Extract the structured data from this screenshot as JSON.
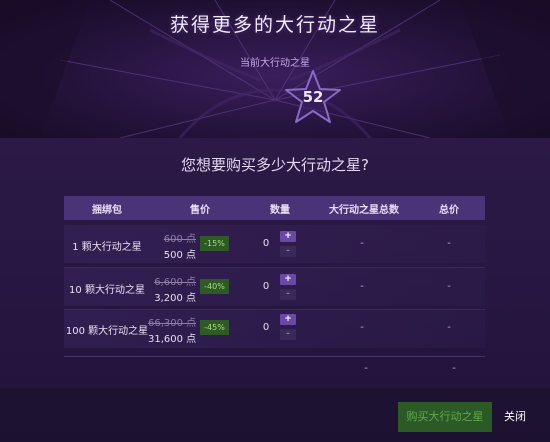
{
  "header": {
    "title": "获得更多的大行动之星",
    "current_label": "当前大行动之星",
    "current_count": "52"
  },
  "question": "您想要购买多少大行动之星?",
  "table": {
    "columns": [
      "捆绑包",
      "售价",
      "数量",
      "大行动之星总数",
      "总价"
    ],
    "rows": [
      {
        "bundle": "1 颗大行动之星",
        "old_price": "600 点",
        "new_price": "500 点",
        "discount": "-15%",
        "quantity": "0",
        "total_stars": "-",
        "total_price": "-"
      },
      {
        "bundle": "10 颗大行动之星",
        "old_price": "6,600 点",
        "new_price": "3,200 点",
        "discount": "-40%",
        "quantity": "0",
        "total_stars": "-",
        "total_price": "-"
      },
      {
        "bundle": "100 颗大行动之星",
        "old_price": "66,300 点",
        "new_price": "31,600 点",
        "discount": "-45%",
        "quantity": "0",
        "total_stars": "-",
        "total_price": "-"
      }
    ],
    "plus_label": "+",
    "minus_label": "-",
    "totals": {
      "total_stars": "-",
      "total_price": "-"
    }
  },
  "footer": {
    "buy_label": "购买大行动之星",
    "close_label": "关闭"
  },
  "colors": {
    "accent": "#6a48a6",
    "discount_bg": "#2f5a28",
    "discount_text": "#a4de78",
    "buy_bg": "#2c5a26"
  },
  "icons": {
    "star": "star-outline-icon"
  }
}
